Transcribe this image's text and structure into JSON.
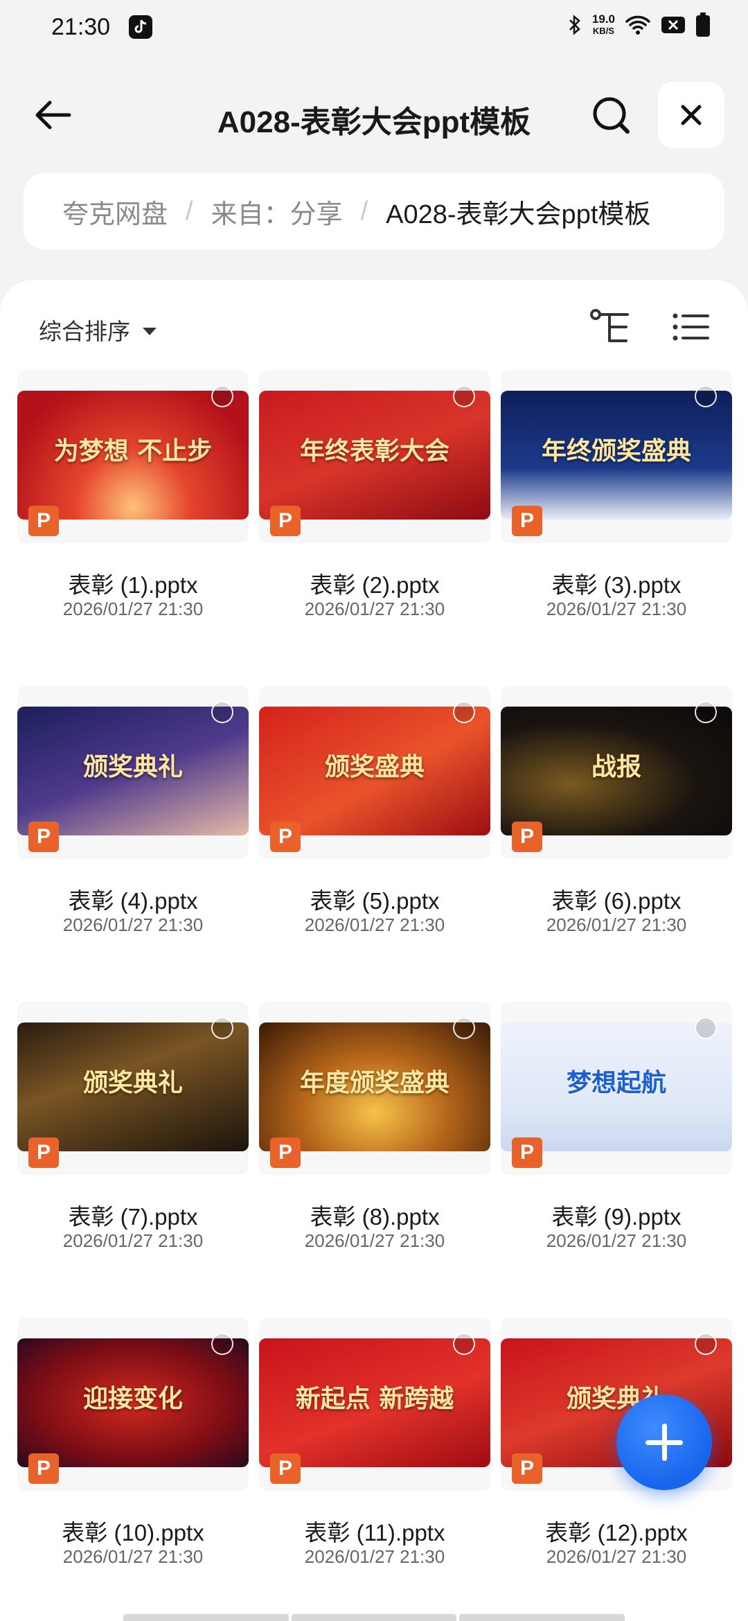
{
  "status_bar": {
    "time": "21:30",
    "net_speed_value": "19.0",
    "net_speed_unit": "KB/S",
    "icons": [
      "tiktok-icon",
      "bluetooth-icon",
      "wifi-icon",
      "sim-off-icon",
      "battery-icon"
    ]
  },
  "header": {
    "title": "A028-表彰大会ppt模板",
    "icons": [
      "back-arrow-icon",
      "search-icon",
      "close-icon"
    ]
  },
  "breadcrumb": {
    "items": [
      "夸克网盘",
      "来自：分享",
      "A028-表彰大会ppt模板"
    ],
    "separator": "/"
  },
  "toolbar": {
    "sort_label": "综合排序",
    "icons": [
      "tree-view-icon",
      "list-view-icon"
    ]
  },
  "files": [
    {
      "name": "表彰 (1).pptx",
      "date": "2026/01/27 21:30",
      "thumb_text": "为梦想 不止步"
    },
    {
      "name": "表彰 (2).pptx",
      "date": "2026/01/27 21:30",
      "thumb_text": "年终表彰大会"
    },
    {
      "name": "表彰 (3).pptx",
      "date": "2026/01/27 21:30",
      "thumb_text": "年终颁奖盛典"
    },
    {
      "name": "表彰 (4).pptx",
      "date": "2026/01/27 21:30",
      "thumb_text": "颁奖典礼"
    },
    {
      "name": "表彰 (5).pptx",
      "date": "2026/01/27 21:30",
      "thumb_text": "颁奖盛典"
    },
    {
      "name": "表彰 (6).pptx",
      "date": "2026/01/27 21:30",
      "thumb_text": "战报"
    },
    {
      "name": "表彰 (7).pptx",
      "date": "2026/01/27 21:30",
      "thumb_text": "颁奖典礼"
    },
    {
      "name": "表彰 (8).pptx",
      "date": "2026/01/27 21:30",
      "thumb_text": "年度颁奖盛典"
    },
    {
      "name": "表彰 (9).pptx",
      "date": "2026/01/27 21:30",
      "thumb_text": "梦想起航"
    },
    {
      "name": "表彰 (10).pptx",
      "date": "2026/01/27 21:30",
      "thumb_text": "迎接变化"
    },
    {
      "name": "表彰 (11).pptx",
      "date": "2026/01/27 21:30",
      "thumb_text": "新起点 新跨越"
    },
    {
      "name": "表彰 (12).pptx",
      "date": "2026/01/27 21:30",
      "thumb_text": "颁奖典礼"
    }
  ],
  "file_type_badge": "P",
  "colors": {
    "accent": "#1765ec",
    "ppt_badge": "#e8622a",
    "background": "#f2f3f5"
  },
  "fab": {
    "icon": "plus-icon"
  }
}
